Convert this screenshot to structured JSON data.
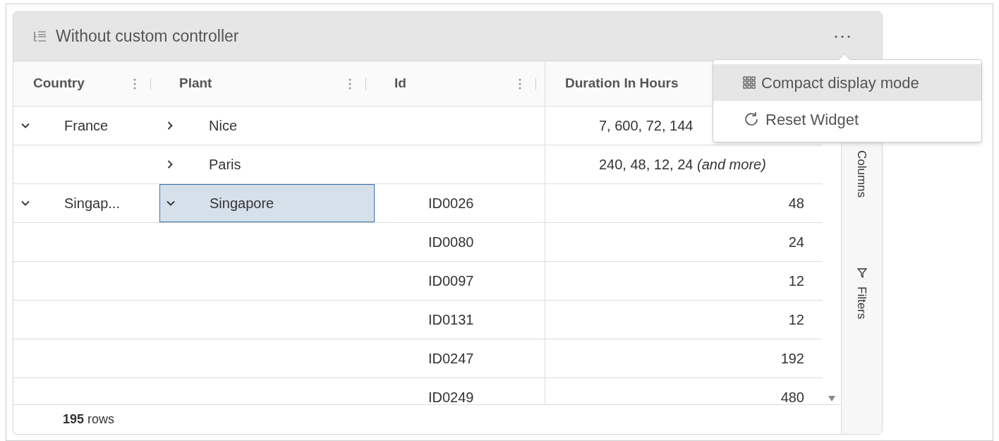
{
  "widget": {
    "title": "Without custom controller"
  },
  "columns": [
    {
      "label": "Country",
      "menu": true
    },
    {
      "label": "Plant",
      "menu": true
    },
    {
      "label": "Id",
      "menu": true
    },
    {
      "label": "Duration In Hours",
      "menu": false
    }
  ],
  "rows": [
    {
      "country": {
        "text": "France",
        "expanded": true
      },
      "plant": {
        "text": "Nice",
        "expanded": false,
        "selected": false
      },
      "id": "",
      "duration": "7, 600, 72, 144",
      "kind": "group"
    },
    {
      "country": null,
      "plant": {
        "text": "Paris",
        "expanded": false,
        "selected": false
      },
      "id": "",
      "duration": "240, 48, 12, 24 *(and more)*",
      "kind": "group"
    },
    {
      "country": {
        "text": "Singap...",
        "expanded": true
      },
      "plant": {
        "text": "Singapore",
        "expanded": true,
        "selected": true
      },
      "id": "ID0026",
      "duration": "48",
      "kind": "leaf"
    },
    {
      "country": null,
      "plant": null,
      "id": "ID0080",
      "duration": "24",
      "kind": "leaf"
    },
    {
      "country": null,
      "plant": null,
      "id": "ID0097",
      "duration": "12",
      "kind": "leaf"
    },
    {
      "country": null,
      "plant": null,
      "id": "ID0131",
      "duration": "12",
      "kind": "leaf"
    },
    {
      "country": null,
      "plant": null,
      "id": "ID0247",
      "duration": "192",
      "kind": "leaf"
    },
    {
      "country": null,
      "plant": null,
      "id": "ID0249",
      "duration": "480",
      "kind": "leaf"
    }
  ],
  "side_panel": [
    {
      "label": "Columns",
      "kind": "columns"
    },
    {
      "label": "Filters",
      "kind": "filters"
    }
  ],
  "footer": {
    "row_count": "**195** rows"
  },
  "menu": {
    "items": [
      {
        "label": "Compact display mode",
        "kind": "grid",
        "selected": true
      },
      {
        "label": "Reset Widget",
        "kind": "reset",
        "selected": false
      }
    ]
  }
}
